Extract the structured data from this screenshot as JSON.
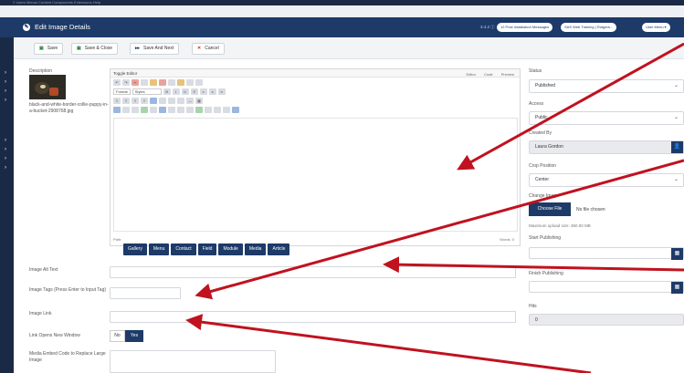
{
  "topmenu": "≡  Users   Menus   Content   Components   Extensions   Help",
  "header": {
    "title": "Edit Image Details",
    "version": "3.4.2 ⓘ",
    "pills": [
      "12  Post Installation Messages",
      "SAS Web Training | Rutgers...",
      "User Menu ▾"
    ]
  },
  "toolbar": {
    "save": "Save",
    "save_close": "Save & Close",
    "save_next": "Save And Next",
    "cancel": "Cancel"
  },
  "description_label": "Description",
  "file_name": "black-and-white-border-collie-puppy-in-a-bucket-2908768.jpg",
  "editor": {
    "toggle": "Toggle Editor",
    "tabs": [
      "Editor",
      "Code",
      "Preview"
    ],
    "format": "Format",
    "styles": "Styles",
    "path": "Path:",
    "words": "Words: 0"
  },
  "editor_buttons": [
    "Gallery",
    "Menu",
    "Contact",
    "Field",
    "Module",
    "Media",
    "Article"
  ],
  "fields": {
    "alt_text": "Image Alt Text",
    "tags": "Image Tags (Press Enter to Input Tag)",
    "link": "Image Link",
    "new_window": "Link Opens New Window",
    "embed": "Media Embed Code to Replace Large Image",
    "toggle_no": "No",
    "toggle_yes": "Yes"
  },
  "right": {
    "status_label": "Status",
    "status_value": "Published",
    "access_label": "Access",
    "access_value": "Public",
    "created_label": "Created By",
    "created_value": "Laura Gordon",
    "crop_label": "Crop Position",
    "crop_value": "Center",
    "change_label": "Change Image",
    "choose_file": "Choose File",
    "no_file": "No file chosen",
    "upload_size": "Maximum upload size: 360.00 MB",
    "start_label": "Start Publishing",
    "finish_label": "Finish Publishing",
    "hits_label": "Hits",
    "hits_value": "0"
  },
  "colors": {
    "brand": "#1d3a68",
    "arrow": "#c0121f"
  }
}
